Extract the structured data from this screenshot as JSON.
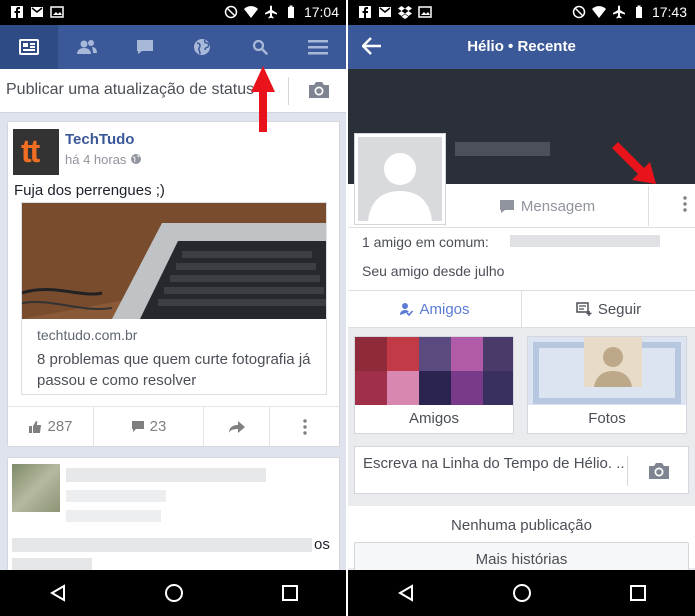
{
  "left": {
    "status_bar": {
      "time": "17:04"
    },
    "nav": {
      "tabs": [
        {
          "icon": "news-feed-icon"
        },
        {
          "icon": "friends-icon"
        },
        {
          "icon": "messages-icon"
        },
        {
          "icon": "globe-icon"
        },
        {
          "icon": "search-icon"
        },
        {
          "icon": "menu-icon"
        }
      ]
    },
    "composer": {
      "placeholder": "Publicar uma atualização de status"
    },
    "post": {
      "author": "TechTudo",
      "time": "há 4 horas",
      "text": "Fuja dos perrengues ;)",
      "link_domain": "techtudo.com.br",
      "link_title": "8 problemas que quem curte fotografia já passou e como resolver",
      "likes": "287",
      "comments": "23",
      "logo_text": "tt"
    },
    "post2": {
      "visible_fragment": "os"
    }
  },
  "right": {
    "status_bar": {
      "time": "17:43"
    },
    "header": {
      "title": "Hélio • Recente"
    },
    "profile": {
      "message_button": "Mensagem",
      "mutual_friends": "1 amigo em comum:",
      "friend_since": "Seu amigo desde julho",
      "friends_button": "Amigos",
      "follow_button": "Seguir"
    },
    "tiles": {
      "friends_label": "Amigos",
      "photos_label": "Fotos"
    },
    "composer": {
      "placeholder": "Escreva na Linha do Tempo de Hélio. .."
    },
    "empty": {
      "text": "Nenhuma publicação",
      "more_button": "Mais histórias"
    }
  },
  "colors": {
    "facebook_blue": "#3b5998",
    "annotation_red": "#e8131b"
  }
}
